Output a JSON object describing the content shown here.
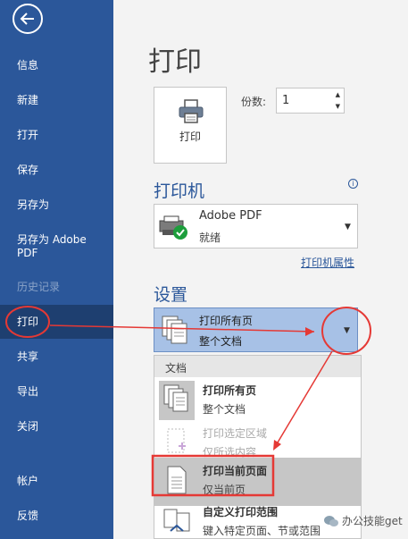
{
  "sidebar": {
    "items": [
      {
        "label": "信息"
      },
      {
        "label": "新建"
      },
      {
        "label": "打开"
      },
      {
        "label": "保存"
      },
      {
        "label": "另存为"
      },
      {
        "label": "另存为 Adobe PDF"
      },
      {
        "label": "历史记录"
      },
      {
        "label": "打印"
      },
      {
        "label": "共享"
      },
      {
        "label": "导出"
      },
      {
        "label": "关闭"
      },
      {
        "label": "帐户"
      },
      {
        "label": "反馈"
      }
    ]
  },
  "main": {
    "title": "打印",
    "print_button_label": "打印",
    "copies_label": "份数:",
    "copies_value": "1",
    "printer_heading": "打印机",
    "printer_name": "Adobe PDF",
    "printer_status": "就绪",
    "printer_properties_link": "打印机属性",
    "settings_heading": "设置",
    "range_dropdown": {
      "title": "打印所有页",
      "subtitle": "整个文档"
    },
    "menu": {
      "header": "文档",
      "items": [
        {
          "title": "打印所有页",
          "subtitle": "整个文档"
        },
        {
          "title": "打印选定区域",
          "subtitle": "仅所选内容"
        },
        {
          "title": "打印当前页面",
          "subtitle": "仅当前页"
        },
        {
          "title": "自定义打印范围",
          "subtitle": "键入特定页面、节或范围"
        }
      ]
    }
  },
  "watermark": {
    "text": "办公技能get"
  },
  "colors": {
    "sidebar": "#2b579a",
    "active": "#1e3f70",
    "annotation": "#e53935",
    "selection": "#a7c1e6"
  }
}
